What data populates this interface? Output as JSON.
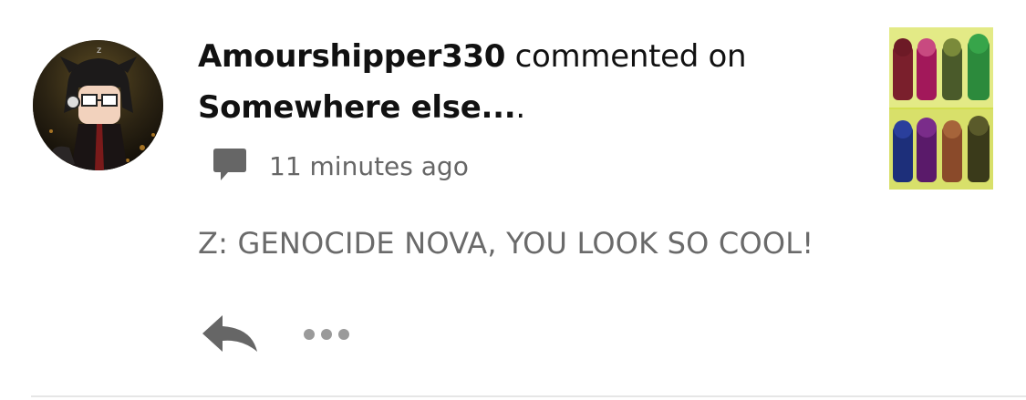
{
  "notification": {
    "username": "Amourshipper330",
    "action_text": " commented on",
    "story_title": "Somewhere else...",
    "title_suffix": ".",
    "timestamp": "11 minutes ago",
    "comment": "Z: GENOCIDE NOVA, YOU LOOK SO COOL!"
  },
  "icons": {
    "comment": "speech-bubble-icon",
    "reply": "reply-arrow-icon",
    "more": "ellipsis-icon"
  },
  "colors": {
    "primary_text": "#111111",
    "secondary_text": "#666666",
    "icon_gray": "#666666",
    "ellipsis_gray": "#9a9a9a",
    "divider": "#e6e6e6"
  }
}
